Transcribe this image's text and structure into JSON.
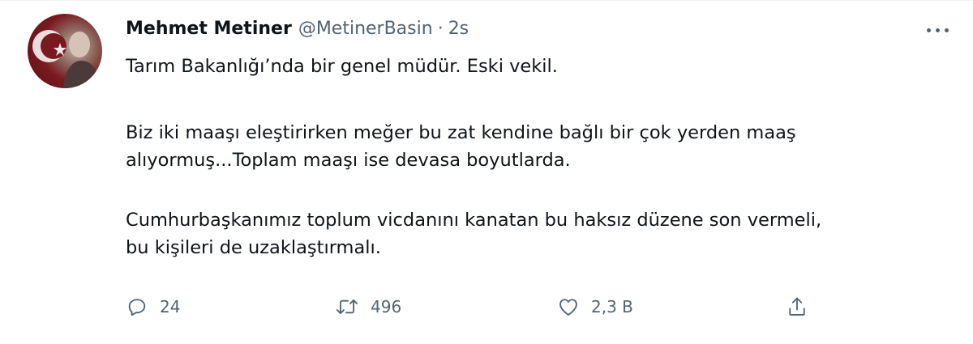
{
  "tweet": {
    "author_name": "Mehmet Metiner",
    "handle": "@MetinerBasin",
    "separator": "·",
    "time": "2s",
    "body": {
      "line1": "Tarım Bakanlığı’nda bir genel müdür. Eski vekil.",
      "para2_line1": "Biz iki maaşı eleştirirken meğer bu zat kendine bağlı bir çok yerden maaş",
      "para2_line2": "alıyormuş...Toplam maaşı ise devasa boyutlarda.",
      "para3_line1": "Cumhurbaşkanımız toplum vicdanını kanatan bu haksız düzene son vermeli,",
      "para3_line2": "bu kişileri de uzaklaştırmalı."
    },
    "actions": {
      "reply_count": "24",
      "retweet_count": "496",
      "like_count": "2,3 B"
    },
    "icons": {
      "reply": "reply-icon",
      "retweet": "retweet-icon",
      "like": "heart-icon",
      "share": "share-icon",
      "more": "more-icon"
    },
    "colors": {
      "text": "#0f1419",
      "muted": "#536471",
      "avatar_red": "#7a1a20"
    }
  }
}
